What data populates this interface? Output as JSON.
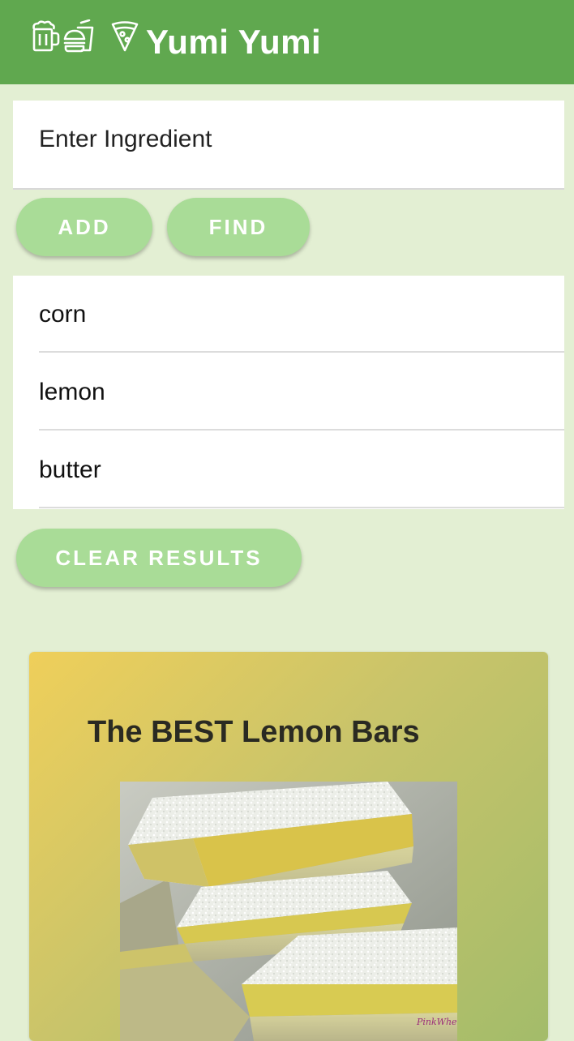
{
  "appbar": {
    "title": "Yumi Yumi",
    "icons": [
      "beer-icon",
      "burger-drink-icon",
      "pizza-icon"
    ],
    "color": "#60a84f"
  },
  "search": {
    "placeholder": "Enter Ingredient"
  },
  "buttons": {
    "add": "ADD",
    "find": "FIND",
    "clear": "CLEAR RESULTS",
    "color": "#a9dc97"
  },
  "ingredients": [
    "corn",
    "lemon",
    "butter"
  ],
  "recipe": {
    "title": "The BEST Lemon Bars",
    "photo_watermark": "PinkWhen"
  }
}
